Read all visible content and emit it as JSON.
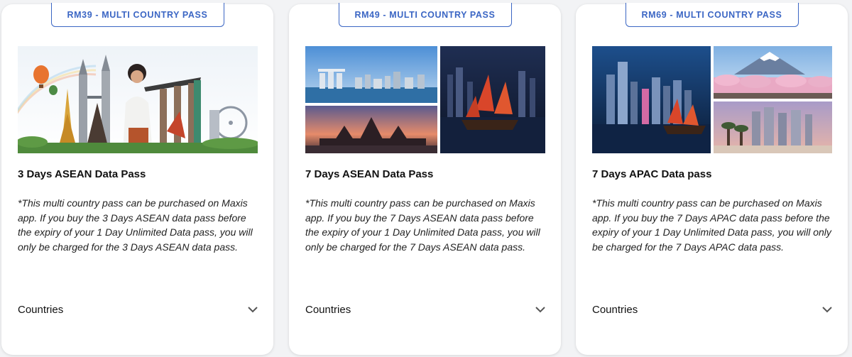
{
  "cards": [
    {
      "badge": "RM39 - MULTI COUNTRY PASS",
      "title": "3 Days ASEAN Data Pass",
      "description": "*This multi country pass can be purchased on Maxis app. If you buy the 3 Days ASEAN data pass before the expiry of your 1 Day Unlimited Data pass, you will only be charged for the 3 Days ASEAN data pass.",
      "countries_label": "Countries",
      "image_icon": "asean-landmarks-collage"
    },
    {
      "badge": "RM49 - MULTI COUNTRY PASS",
      "title": "7 Days ASEAN Data Pass",
      "description": "*This multi country pass can be purchased on Maxis app. If you buy the 7 Days ASEAN data pass before the expiry of your 1 Day Unlimited Data pass, you will only be charged for the 7 Days ASEAN data pass.",
      "countries_label": "Countries",
      "image_icon": "asean-cities-collage"
    },
    {
      "badge": "RM69 - MULTI COUNTRY PASS",
      "title": "7 Days APAC Data pass",
      "description": "*This multi country pass can be purchased on Maxis app. If you buy the 7 Days APAC data pass before the expiry of your 1 Day Unlimited Data pass, you will only be charged for the 7 Days APAC data pass.",
      "countries_label": "Countries",
      "image_icon": "apac-cities-collage"
    }
  ],
  "colors": {
    "accent": "#3b66c4",
    "card_bg": "#ffffff",
    "page_bg": "#f2f3f5"
  }
}
